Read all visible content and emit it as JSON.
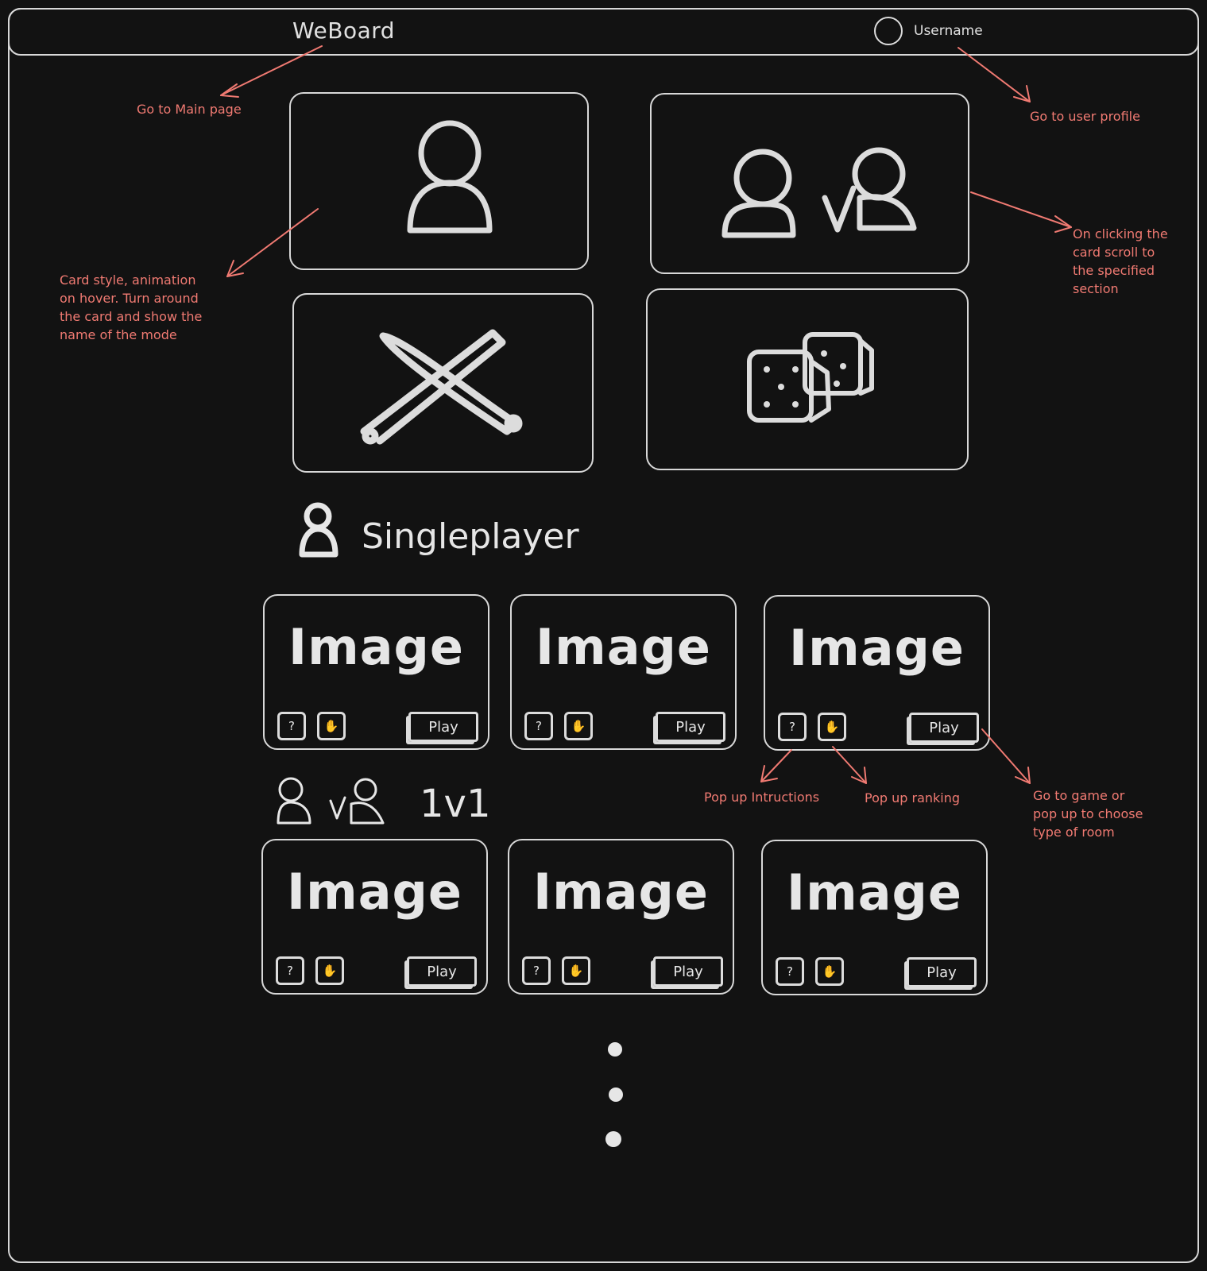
{
  "header": {
    "brand": "WeBoard",
    "username": "Username"
  },
  "annotations": {
    "main_page": "Go to Main page",
    "user_profile": "Go to user profile",
    "card_style": [
      "Card style, animation",
      "on hover. Turn around",
      "the card and show the",
      "name of the mode"
    ],
    "card_scroll": [
      "On clicking the",
      "card scroll to",
      "the specified",
      "section"
    ],
    "instructions": "Pop up Intructions",
    "ranking": "Pop up ranking",
    "play_action": [
      "Go to game or",
      "pop up to choose",
      "type of room"
    ]
  },
  "mode_cards": [
    {
      "icon": "single-player-icon"
    },
    {
      "icon": "versus-icon"
    },
    {
      "icon": "crossed-swords-icon"
    },
    {
      "icon": "dice-icon"
    }
  ],
  "sections": [
    {
      "title": "Singleplayer",
      "icon": "single-player-icon",
      "games": [
        {
          "image": "Image",
          "help": "?",
          "play": "Play"
        },
        {
          "image": "Image",
          "help": "?",
          "play": "Play"
        },
        {
          "image": "Image",
          "help": "?",
          "play": "Play"
        }
      ]
    },
    {
      "title": "1v1",
      "icon": "versus-icon",
      "games": [
        {
          "image": "Image",
          "help": "?",
          "play": "Play"
        },
        {
          "image": "Image",
          "help": "?",
          "play": "Play"
        },
        {
          "image": "Image",
          "help": "?",
          "play": "Play"
        }
      ]
    }
  ],
  "colors": {
    "background": "#121212",
    "stroke": "#d8d8d8",
    "annotation": "#f07a72"
  }
}
